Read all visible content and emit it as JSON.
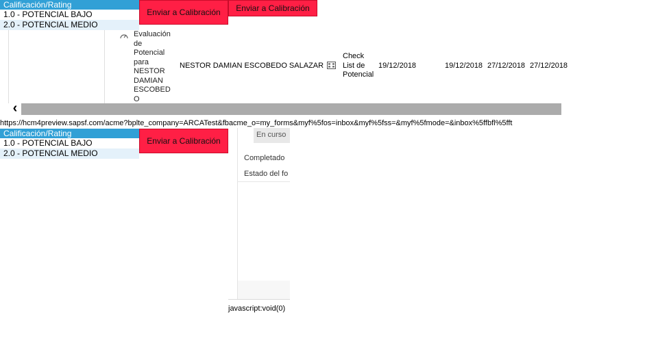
{
  "rating_panels": [
    {
      "header": "Calificación/Rating",
      "items": [
        "1.0 - POTENCIAL BAJO",
        "2.0 - POTENCIAL MEDIO"
      ]
    },
    {
      "header": "Calificación/Rating",
      "items": [
        "1.0 - POTENCIAL BAJO",
        "2.0 - POTENCIAL MEDIO"
      ]
    }
  ],
  "buttons": {
    "calibrate_1": "Enviar a Calibración",
    "calibrate_2": "Enviar a Calibración",
    "calibrate_3": "Enviar a Calibración"
  },
  "row": {
    "form_title": "Evaluación de Potencial para NESTOR DAMIAN ESCOBEDO SALAZAR",
    "employee": "NESTOR DAMIAN ESCOBEDO SALAZAR",
    "step": "Check List de Potencial",
    "date_1": "19/12/2018",
    "date_2": "19/12/2018",
    "date_3": "27/12/2018",
    "date_4": "27/12/2018"
  },
  "scroll": {
    "left_arrow": "‹"
  },
  "url_text": "https://hcm4preview.sapsf.com/acme?bplte_company=ARCATest&fbacme_o=my_forms&myf%5fos=inbox&myf%5fss=&myf%5fmode=&inbox%5ffbfl%5fft",
  "side_panel": {
    "tab_label": "En curso",
    "completed_label": "Completado",
    "status_label": "Estado del fo"
  },
  "status_url": "javascript:void(0)",
  "colors": {
    "rating_header": "#31a0d6",
    "rating_alt_row": "#e4f1fa",
    "calibrate_button": "#ff1f45",
    "scrollbar": "#ababab"
  }
}
